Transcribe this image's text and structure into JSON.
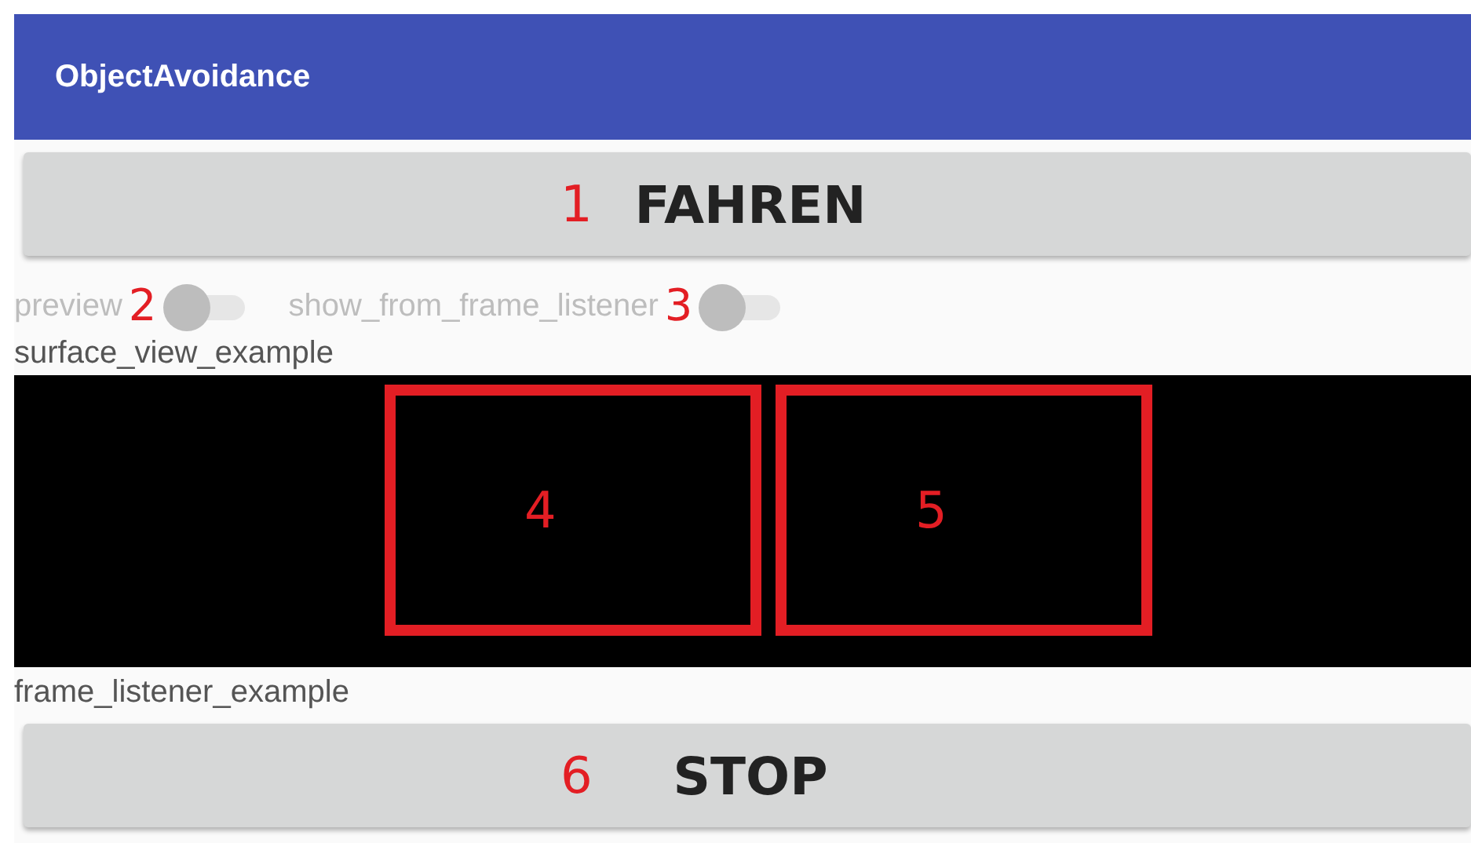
{
  "app_bar": {
    "title": "ObjectAvoidance"
  },
  "buttons_top": [
    {
      "label": "FAHREN",
      "marker": "1"
    }
  ],
  "switches": [
    {
      "label": "preview",
      "on": false,
      "disabled": true,
      "marker": "2"
    },
    {
      "label": "show_from_frame_listener",
      "on": false,
      "disabled": true,
      "marker": "3"
    }
  ],
  "surface_label": "surface_view_example",
  "preview_frames": [
    {
      "marker": "4"
    },
    {
      "marker": "5"
    }
  ],
  "frame_label": "frame_listener_example",
  "buttons_bottom": [
    {
      "label": "STOP",
      "marker": "6"
    }
  ]
}
